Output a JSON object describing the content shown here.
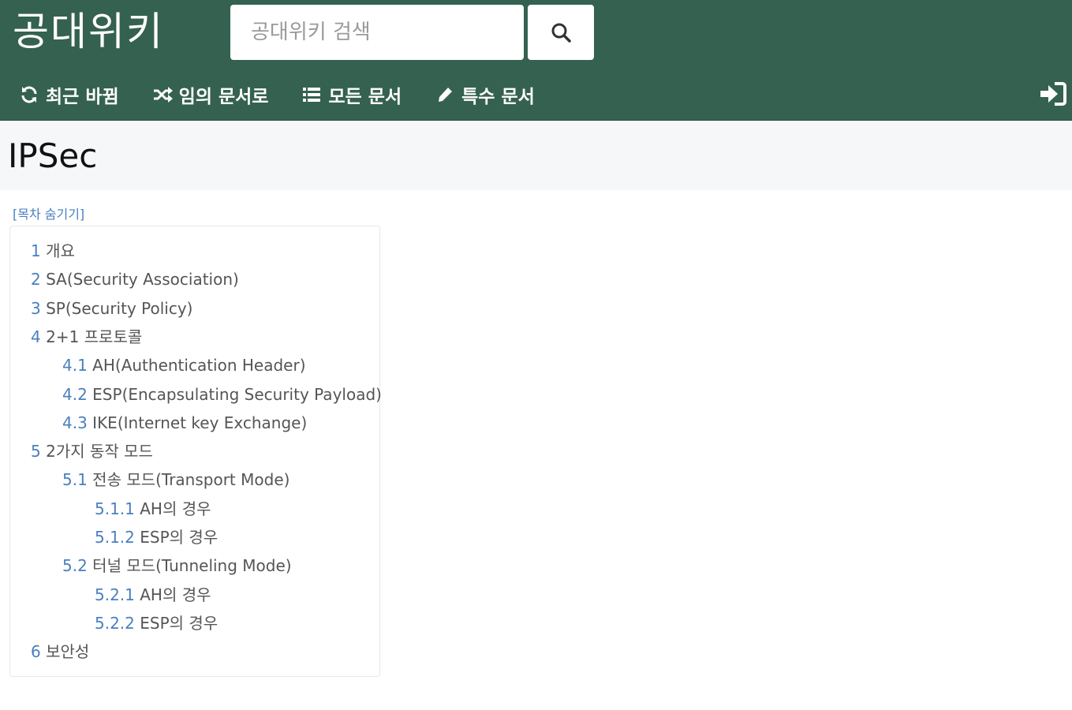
{
  "header": {
    "logo": "공대위키",
    "search_placeholder": "공대위키 검색",
    "nav": [
      {
        "label": "최근 바뀜",
        "icon": "refresh-icon"
      },
      {
        "label": "임의 문서로",
        "icon": "shuffle-icon"
      },
      {
        "label": "모든 문서",
        "icon": "list-icon"
      },
      {
        "label": "특수 문서",
        "icon": "pencil-icon"
      }
    ],
    "login_icon": "login-icon"
  },
  "page": {
    "title": "IPSec"
  },
  "toc": {
    "toggle_label": "[목차 숨기기]",
    "items": [
      {
        "num": "1",
        "text": "개요",
        "level": 1
      },
      {
        "num": "2",
        "text": "SA(Security Association)",
        "level": 1
      },
      {
        "num": "3",
        "text": "SP(Security Policy)",
        "level": 1
      },
      {
        "num": "4",
        "text": "2+1 프로토콜",
        "level": 1
      },
      {
        "num": "4.1",
        "text": "AH(Authentication Header)",
        "level": 2
      },
      {
        "num": "4.2",
        "text": "ESP(Encapsulating Security Payload)",
        "level": 2
      },
      {
        "num": "4.3",
        "text": "IKE(Internet key Exchange)",
        "level": 2
      },
      {
        "num": "5",
        "text": "2가지 동작 모드",
        "level": 1
      },
      {
        "num": "5.1",
        "text": "전송 모드(Transport Mode)",
        "level": 2
      },
      {
        "num": "5.1.1",
        "text": "AH의 경우",
        "level": 3
      },
      {
        "num": "5.1.2",
        "text": "ESP의 경우",
        "level": 3
      },
      {
        "num": "5.2",
        "text": "터널 모드(Tunneling Mode)",
        "level": 2
      },
      {
        "num": "5.2.1",
        "text": "AH의 경우",
        "level": 3
      },
      {
        "num": "5.2.2",
        "text": "ESP의 경우",
        "level": 3
      },
      {
        "num": "6",
        "text": "보안성",
        "level": 1
      }
    ]
  }
}
